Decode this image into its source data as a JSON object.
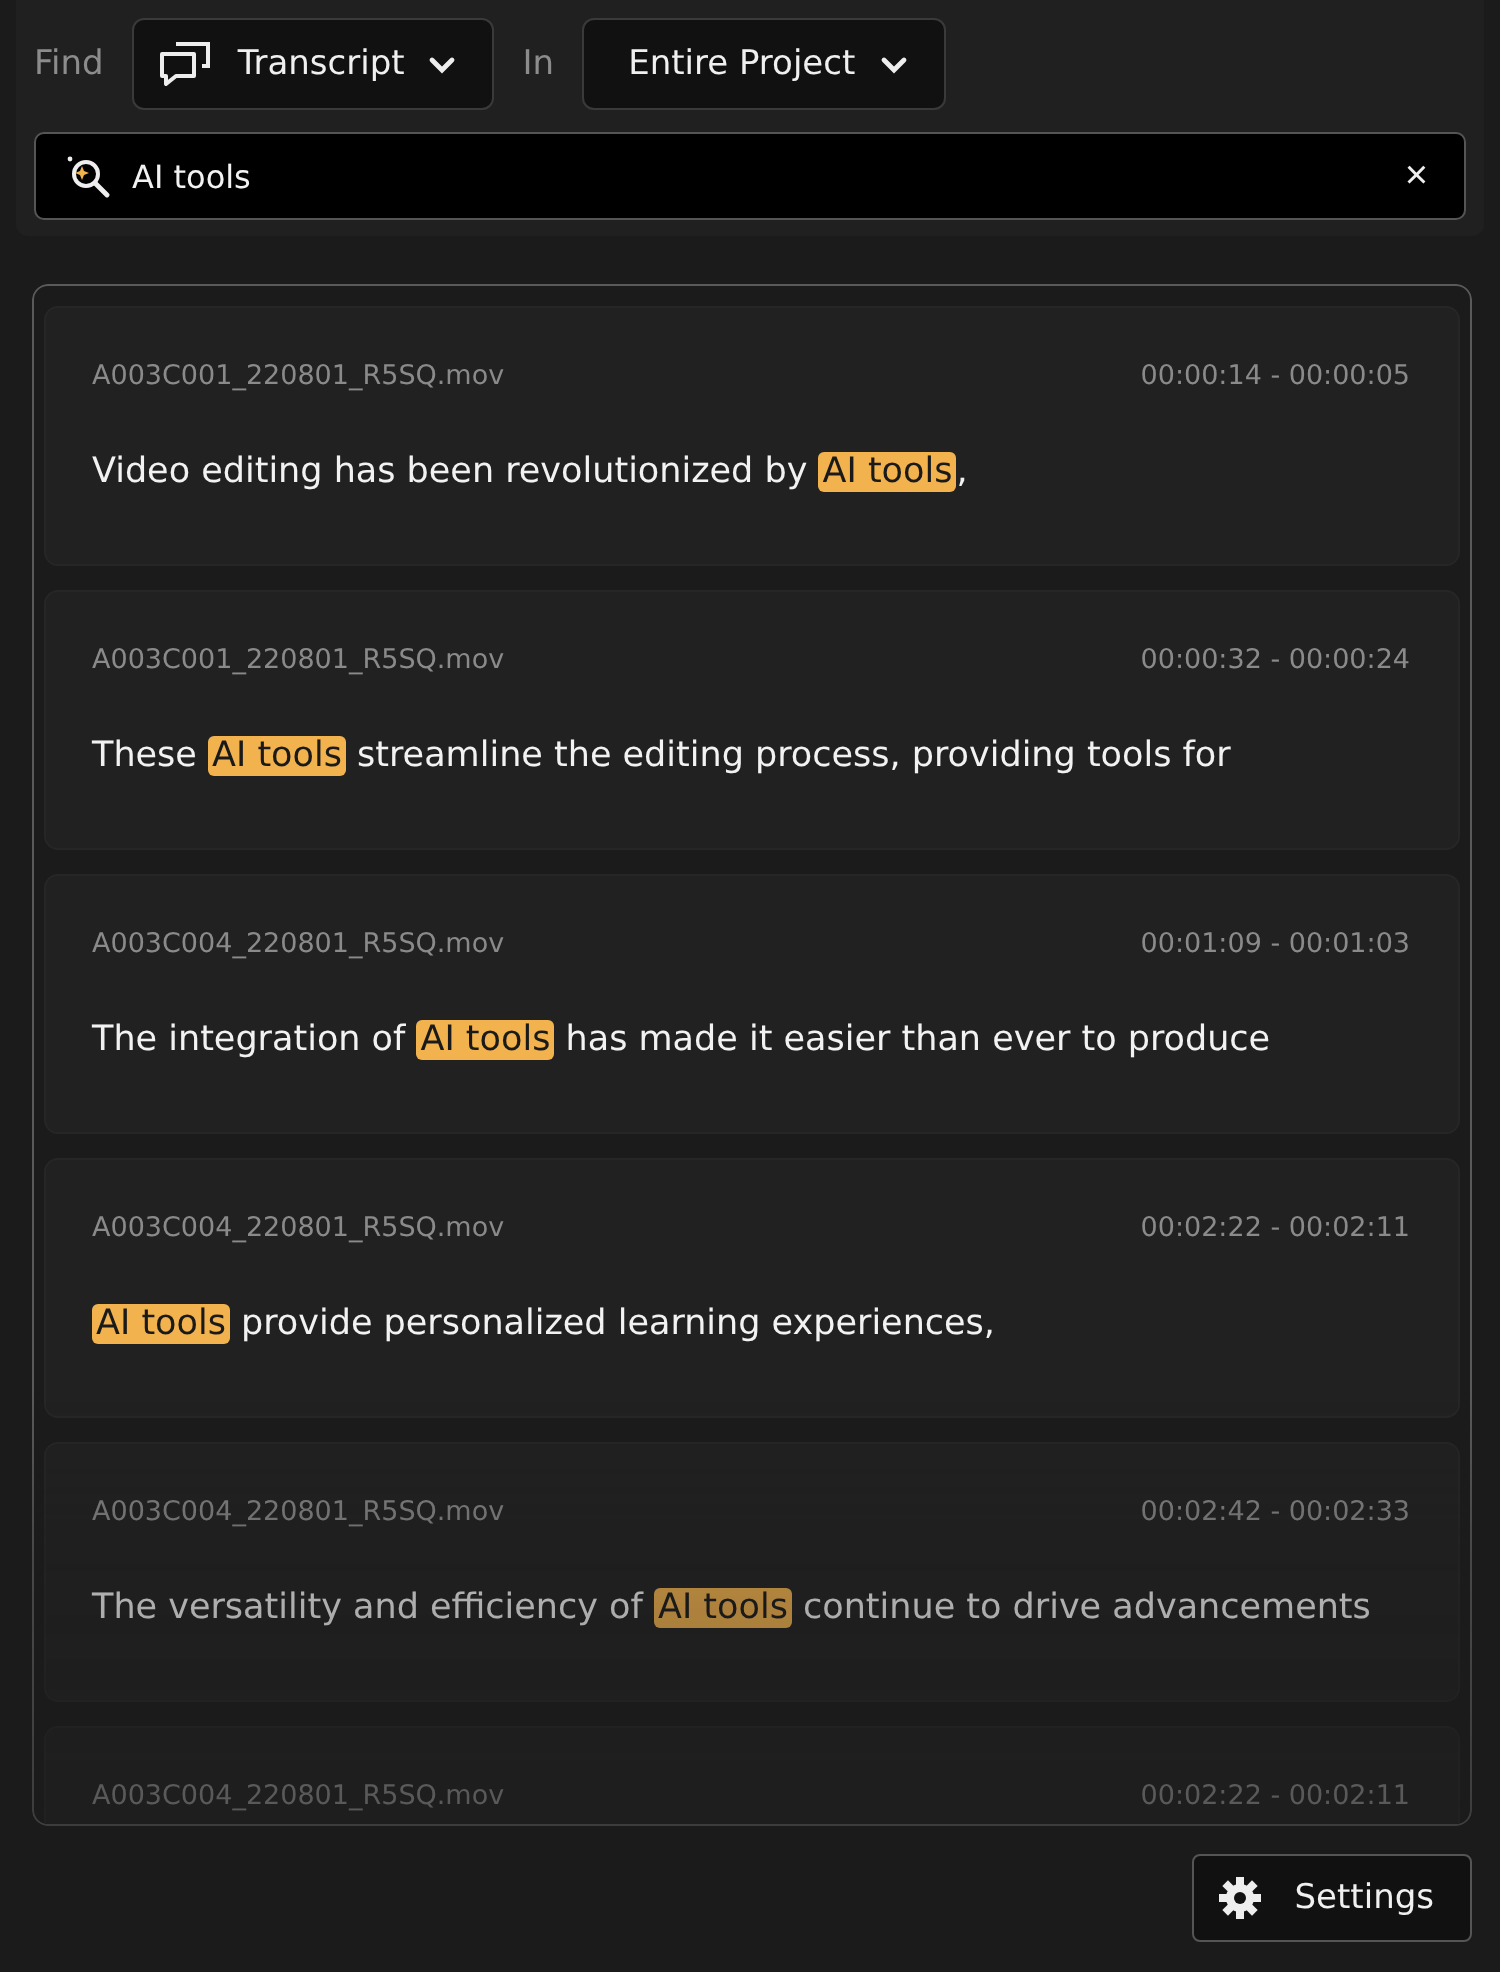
{
  "find_bar": {
    "find_label": "Find",
    "scope_dropdown": {
      "value": "Transcript"
    },
    "in_label": "In",
    "range_dropdown": {
      "value": "Entire Project"
    }
  },
  "search": {
    "value": "AI tools",
    "clear": "×"
  },
  "results": [
    {
      "file": "A003C001_220801_R5SQ.mov",
      "time": "00:00:14 - 00:00:05",
      "before": "Video editing has been revolutionized by ",
      "match": "AI tools",
      "after": ","
    },
    {
      "file": "A003C001_220801_R5SQ.mov",
      "time": "00:00:32 - 00:00:24",
      "before": "These ",
      "match": "AI tools",
      "after": " streamline the editing process, providing tools for"
    },
    {
      "file": "A003C004_220801_R5SQ.mov",
      "time": "00:01:09 - 00:01:03",
      "before": "The integration of ",
      "match": "AI tools",
      "after": " has made it easier than ever to produce"
    },
    {
      "file": "A003C004_220801_R5SQ.mov",
      "time": "00:02:22 - 00:02:11",
      "match": "AI tools",
      "after": " provide personalized learning experiences,"
    },
    {
      "file": "A003C004_220801_R5SQ.mov",
      "time": "00:02:42 - 00:02:33",
      "before": "The versatility and efficiency of ",
      "match": "AI tools",
      "after": " continue to drive advancements"
    },
    {
      "file": "A003C004_220801_R5SQ.mov",
      "time": "00:02:22 - 00:02:11"
    }
  ],
  "settings_button": {
    "label": "Settings"
  }
}
